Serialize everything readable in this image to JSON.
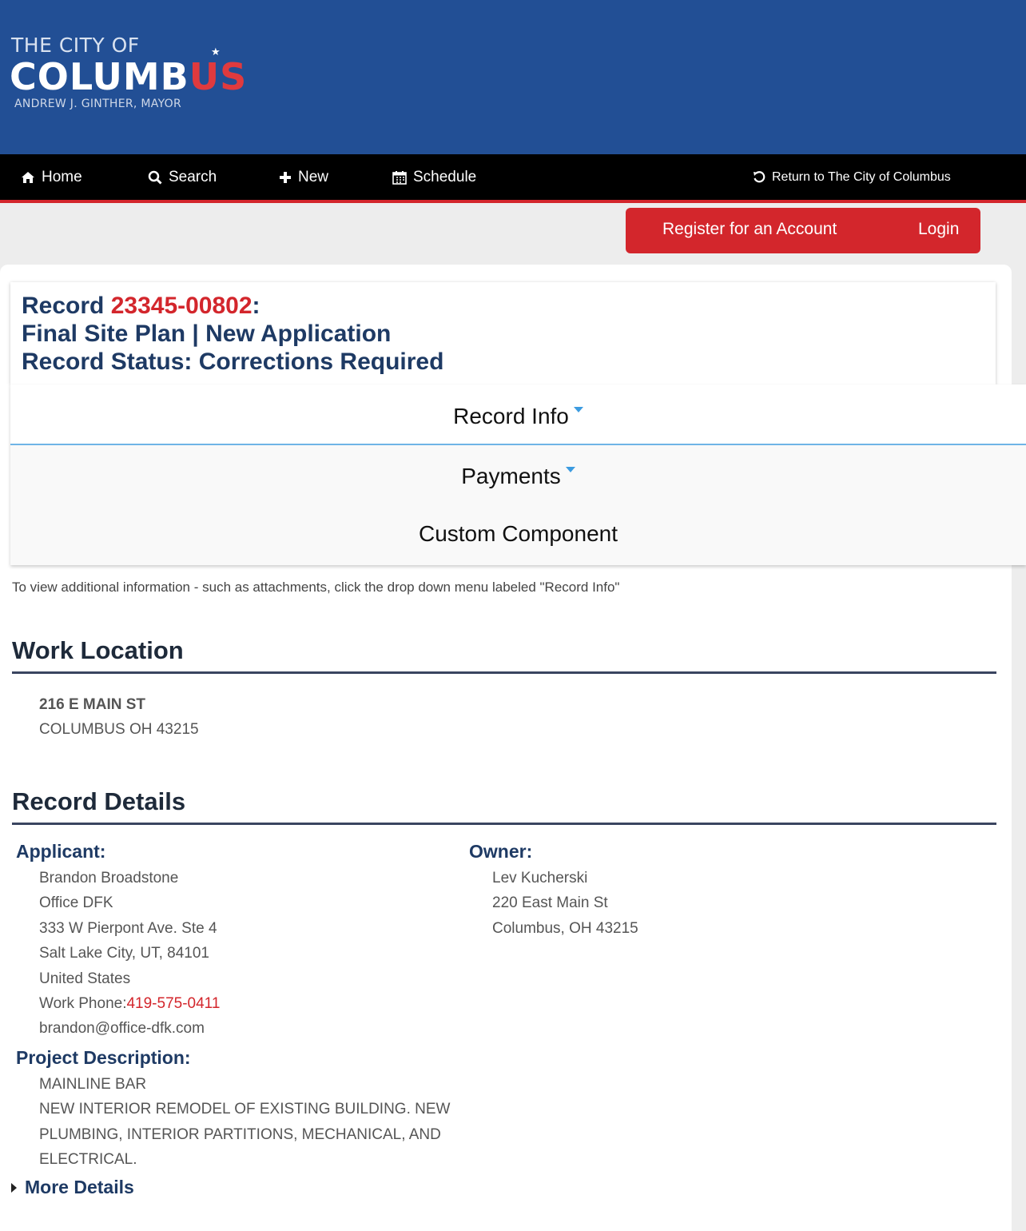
{
  "logo": {
    "line1": "THE CITY OF",
    "line2_main": "COLUMB",
    "line2_accent": "US",
    "line3": "ANDREW J. GINTHER, MAYOR"
  },
  "nav": {
    "home": "Home",
    "search": "Search",
    "new": "New",
    "schedule": "Schedule",
    "return": "Return to The City of Columbus"
  },
  "auth": {
    "register": "Register for an Account",
    "login": "Login"
  },
  "record": {
    "prefix": "Record ",
    "number": "23345-00802",
    "suffix": ":",
    "type": "Final Site Plan | New Application",
    "status": "Record Status: Corrections Required"
  },
  "menu": {
    "record_info": "Record Info",
    "payments": "Payments",
    "custom": "Custom Component"
  },
  "info_text": "To view additional information - such as attachments, click the drop down menu labeled \"Record Info\"",
  "work_location": {
    "title": "Work Location",
    "line1": "216 E MAIN ST",
    "line2": "COLUMBUS OH 43215"
  },
  "record_details": {
    "title": "Record Details",
    "applicant_label": "Applicant:",
    "applicant": {
      "name": "Brandon Broadstone",
      "company": "Office DFK",
      "street": "333 W Pierpont Ave. Ste 4",
      "city": "Salt Lake City, UT, 84101",
      "country": "United States",
      "phone_label": "Work Phone:",
      "phone": "419-575-0411",
      "email": "brandon@office-dfk.com"
    },
    "owner_label": "Owner:",
    "owner": {
      "name": "Lev Kucherski",
      "street": "220 East Main St",
      "city": "Columbus, OH 43215"
    },
    "project_label": "Project Description:",
    "project": {
      "name": "MAINLINE BAR",
      "line1": "NEW INTERIOR REMODEL OF EXISTING BUILDING. NEW",
      "line2": "PLUMBING, INTERIOR PARTITIONS, MECHANICAL, AND",
      "line3": "ELECTRICAL."
    },
    "more": "More Details"
  },
  "colors": {
    "header_blue": "#224f95",
    "accent_red": "#d3262c",
    "heading_navy": "#1e3a64"
  }
}
